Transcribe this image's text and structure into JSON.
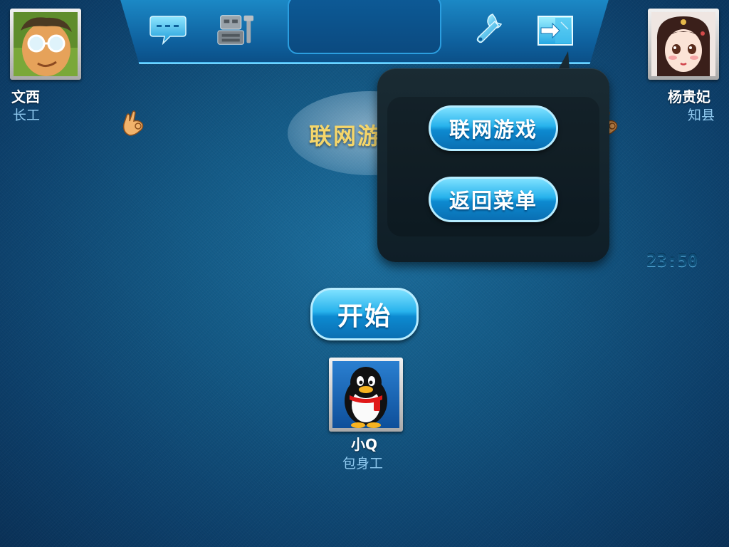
{
  "toolbar": {
    "buttons": [
      {
        "name": "chat",
        "icon": "chat-bubble-icon"
      },
      {
        "name": "robot",
        "icon": "robot-icon"
      },
      {
        "name": "settings",
        "icon": "wrench-icon"
      },
      {
        "name": "exit",
        "icon": "exit-door-icon"
      }
    ]
  },
  "players": {
    "left": {
      "name": "文西",
      "rank": "长工"
    },
    "right": {
      "name": "杨贵妃",
      "rank": "知县"
    },
    "self": {
      "name": "小Q",
      "rank": "包身工"
    }
  },
  "hint": {
    "label": "联网游戏"
  },
  "popup": {
    "online_label": "联网游戏",
    "back_label": "返回菜单"
  },
  "start_label": "开始",
  "clock": "23:50",
  "colors": {
    "accent": "#27b2ec",
    "hint_text": "#f5d66a",
    "background": "#145a86"
  }
}
